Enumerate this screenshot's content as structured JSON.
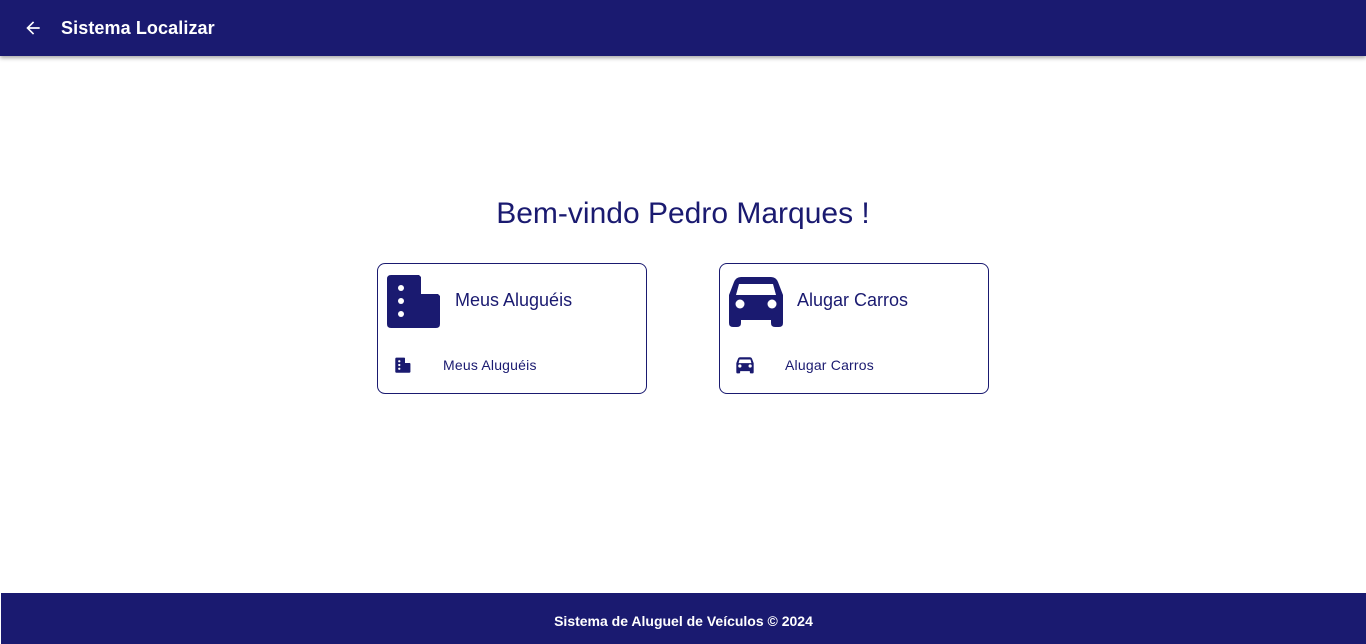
{
  "toolbar": {
    "back_icon": "arrow-back-icon",
    "title": "Sistema Localizar"
  },
  "main": {
    "welcome": "Bem-vindo Pedro Marques !",
    "cards": [
      {
        "icon": "description-icon",
        "title": "Meus Aluguéis",
        "action_icon": "description-icon",
        "action_label": "Meus Aluguéis"
      },
      {
        "icon": "car-icon",
        "title": "Alugar Carros",
        "action_icon": "car-icon",
        "action_label": "Alugar Carros"
      }
    ]
  },
  "footer": {
    "text": "Sistema de Aluguel de Veículos © 2024"
  },
  "colors": {
    "primary": "#1a1a70",
    "background": "#ffffff",
    "on_primary": "#ffffff"
  }
}
